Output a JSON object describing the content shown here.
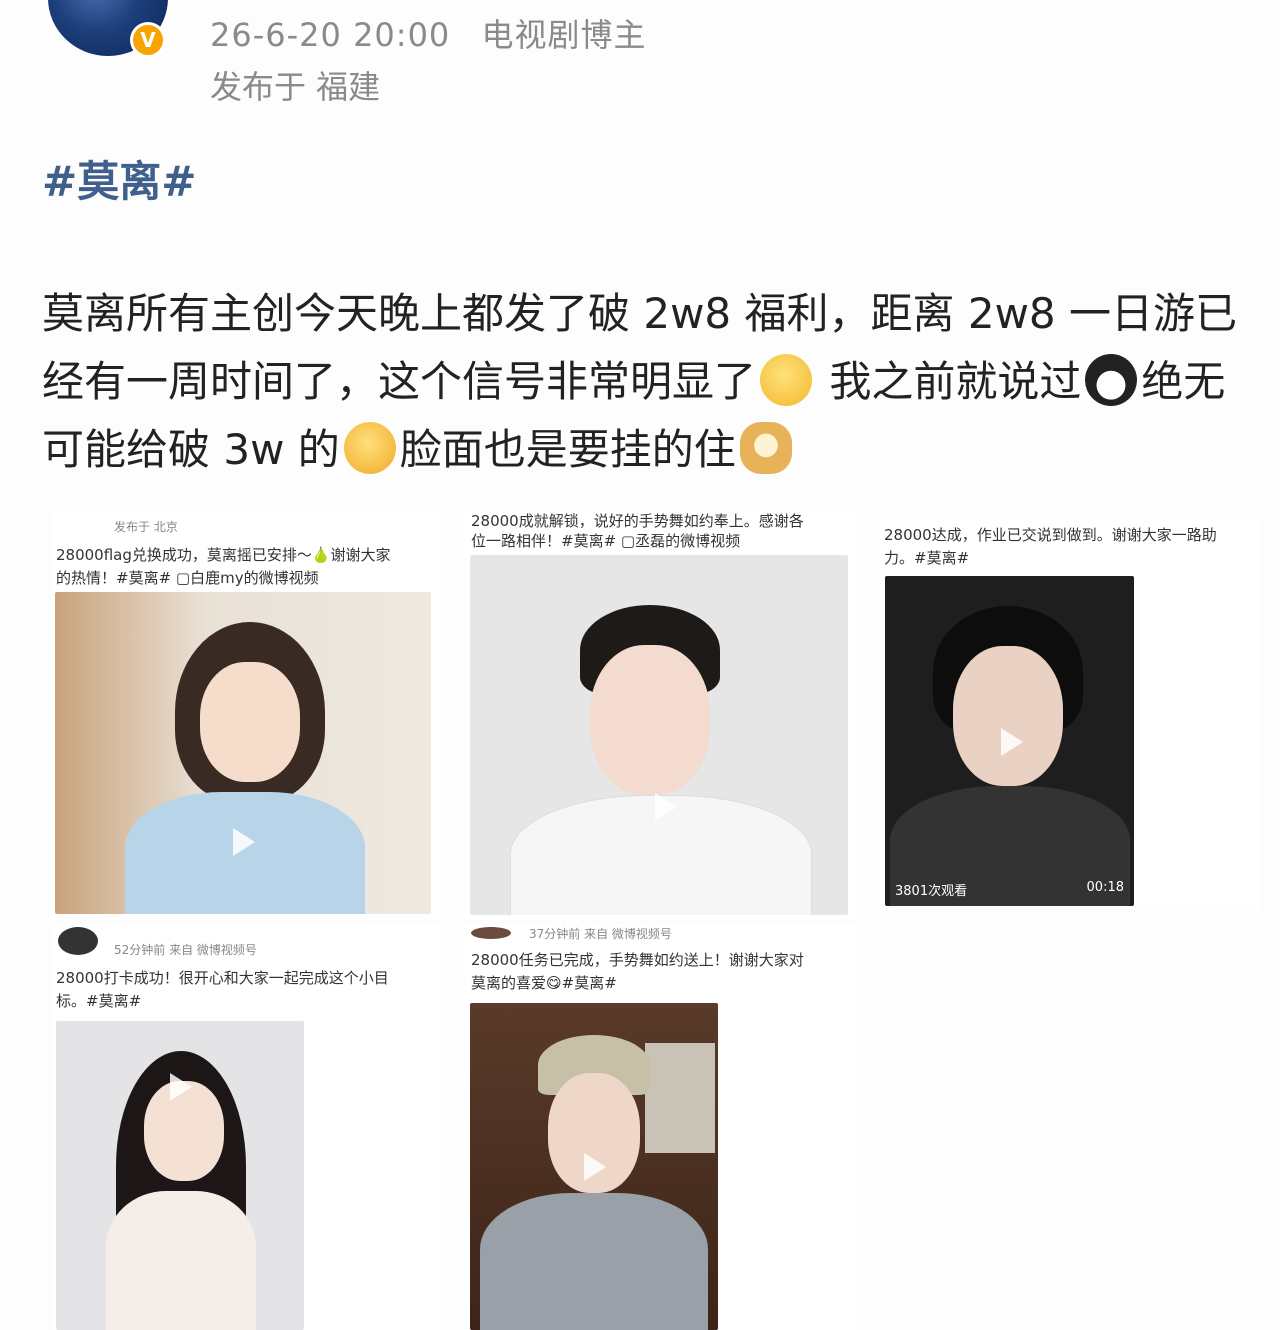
{
  "header": {
    "time": "26-6-20 20:00",
    "author": "电视剧博主",
    "location_label": "发布于 福建",
    "badge": "V"
  },
  "post": {
    "topic": "#莫离#",
    "text_1": "莫离所有主创今天晚上都发了破 2w8 福利，距离 2w8 一日游已经有一周时间了，这个信号非常明显了",
    "text_2": " 我之前就说过",
    "text_3": "绝无可能给破 3w 的",
    "text_4": "脸面也是要挂的住",
    "emojis": [
      "smirk-emoji",
      "penguin-emoji",
      "tongue-emoji",
      "doge-emoji"
    ]
  },
  "cards": [
    {
      "meta": "发布于 北京",
      "caption": "28000flag兑换成功，莫离摇已安排～🍐谢谢大家\n的热情！#莫离# ▢白鹿my的微博视频",
      "colors": {
        "bg": "#d9c9b5",
        "person": "#b8d4e8"
      }
    },
    {
      "meta": "28000成就解锁，说好的手势舞如约奉上。感谢各",
      "caption": "位一路相伴！#莫离# ▢丞磊的微博视频",
      "colors": {
        "bg": "#e6e6e6",
        "person": "#f2f2f2"
      }
    },
    {
      "caption": "28000达成，作业已交说到做到。谢谢大家一路助\n力。#莫离#",
      "views": "3801次观看",
      "duration": "00:18",
      "colors": {
        "bg": "#1e1e1e",
        "person": "#333333"
      }
    },
    {
      "meta": "52分钟前  来自 微博视频号",
      "caption": "28000打卡成功！很开心和大家一起完成这个小目\n标。#莫离#",
      "colors": {
        "bg": "#e4e4e6",
        "person": "#f5eee8"
      }
    },
    {
      "meta": "37分钟前  来自 微博视频号",
      "caption": "28000任务已完成，手势舞如约送上！谢谢大家对\n莫离的喜爱😋#莫离#",
      "colors": {
        "bg": "#5a3a2a",
        "person": "#9aa0a8"
      }
    }
  ]
}
